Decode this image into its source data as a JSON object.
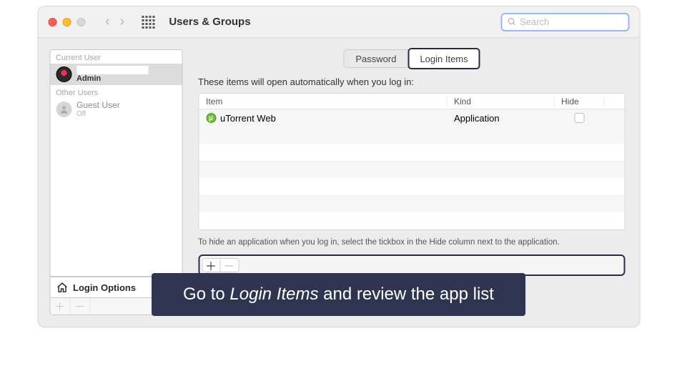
{
  "header": {
    "title": "Users & Groups",
    "search_placeholder": "Search"
  },
  "sidebar": {
    "current_user_header": "Current User",
    "other_users_header": "Other Users",
    "admin_role": "Admin",
    "guest_name": "Guest User",
    "guest_status": "Off",
    "login_options_label": "Login Options"
  },
  "tabs": {
    "password": "Password",
    "login_items": "Login Items"
  },
  "main": {
    "description": "These items will open automatically when you log in:",
    "columns": {
      "item": "Item",
      "kind": "Kind",
      "hide": "Hide"
    },
    "rows": [
      {
        "name": "uTorrent Web",
        "kind": "Application",
        "hide": false
      }
    ],
    "hint": "To hide an application when you log in, select the tickbox in the Hide column next to the application."
  },
  "caption": {
    "prefix": "Go to ",
    "em": "Login Items",
    "suffix": " and review the app list"
  }
}
